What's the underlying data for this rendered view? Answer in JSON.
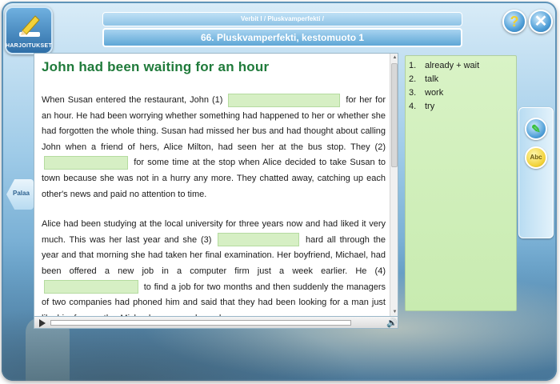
{
  "app": {
    "logo_label": "HARJOITUKSET",
    "breadcrumb": "Verbit I / Pluskvamperfekti /",
    "title": "66. Pluskvamperfekti, kestomuoto 1",
    "help_label": "?",
    "close_label": "✕",
    "back_label": "Palaa"
  },
  "exercise": {
    "heading": "John had been waiting for an hour",
    "p1": {
      "t0": "When Susan entered the restaurant, John (1)",
      "t1": "for her for an hour. He had been worrying whether something had happened to her or whether she had forgotten the whole thing. Susan had missed her bus and had thought about calling John when a friend of hers, Alice Milton, had seen her at the bus stop. They (2)",
      "t2": "for some time at the stop when Alice decided to take Susan to town because she was not in a hurry any more. They chatted away, catching up each other's news and paid no attention to time."
    },
    "p2": {
      "t0": "Alice had been studying at the local university for three years now and had liked it very much. This was her last year and she (3)",
      "t1": "hard all through the year and that morning she had taken her final examination. Her boyfriend, Michael, had been offered a new job in a computer firm just a week earlier. He (4)",
      "t2": "to find a job for two months and then suddenly the managers of two companies had phoned him and said that they had been looking for a man just like him for months. Michael was very pleased."
    }
  },
  "answers": [
    {
      "num": "1.",
      "text": "already + wait"
    },
    {
      "num": "2.",
      "text": "talk"
    },
    {
      "num": "3.",
      "text": "work"
    },
    {
      "num": "4.",
      "text": "try"
    }
  ],
  "tools": {
    "abc_label": "Abc"
  },
  "colors": {
    "heading": "#1f7a3a",
    "blank_fill": "#d6efc4",
    "answer_panel": "#d9f3c6"
  }
}
